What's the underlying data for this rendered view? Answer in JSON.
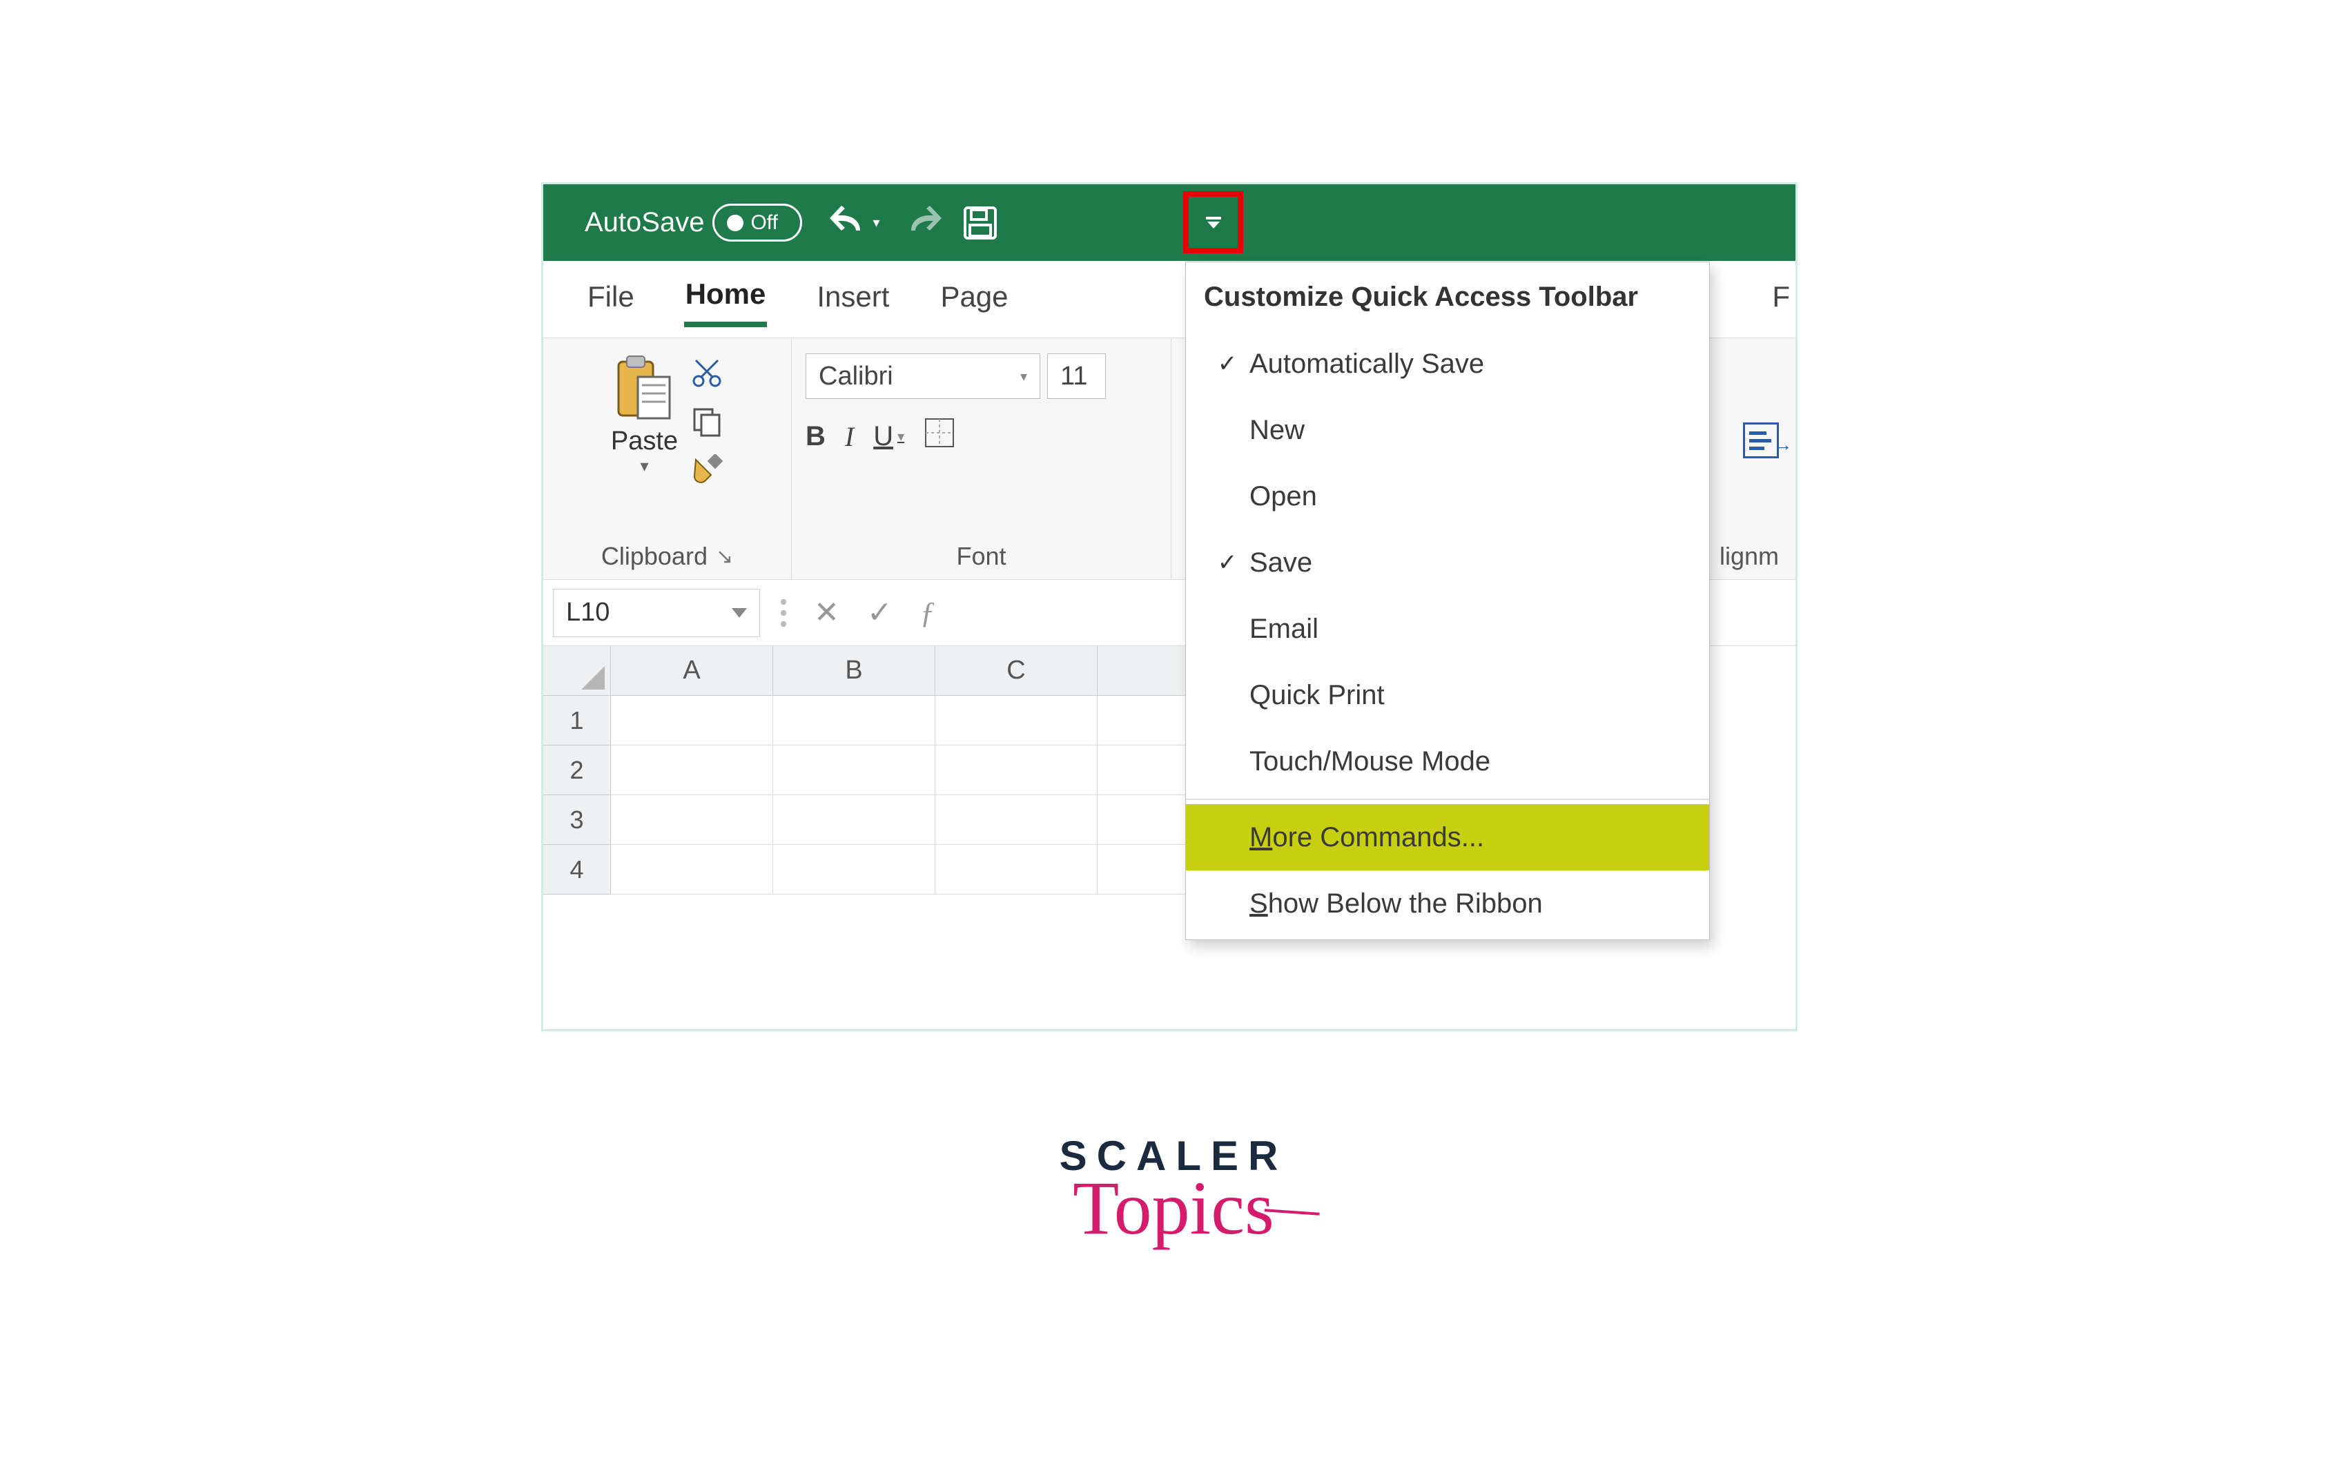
{
  "titlebar": {
    "autosave_label": "AutoSave",
    "autosave_state": "Off"
  },
  "tabs": {
    "file": "File",
    "home": "Home",
    "insert": "Insert",
    "pagelayout": "Page",
    "right_peek": "F"
  },
  "ribbon": {
    "clipboard": {
      "paste": "Paste",
      "label": "Clipboard"
    },
    "font": {
      "name": "Calibri",
      "size": "11",
      "label": "Font"
    },
    "alignment": {
      "label_partial": "lignm"
    }
  },
  "formula": {
    "namebox": "L10"
  },
  "columns": [
    "A",
    "B",
    "C",
    ""
  ],
  "rows": [
    "1",
    "2",
    "3",
    "4"
  ],
  "dropdown": {
    "title": "Customize Quick Access Toolbar",
    "items": [
      {
        "label": "Automatically Save",
        "checked": true
      },
      {
        "label": "New",
        "checked": false
      },
      {
        "label": "Open",
        "checked": false
      },
      {
        "label": "Save",
        "checked": true
      },
      {
        "label": "Email",
        "checked": false
      },
      {
        "label": "Quick Print",
        "checked": false
      },
      {
        "label": "Touch/Mouse Mode",
        "checked": false
      }
    ],
    "more_commands": "More Commands...",
    "more_commands_key": "M",
    "show_below": "Show Below the Ribbon",
    "show_below_key": "S"
  },
  "watermark": {
    "line1": "SCALER",
    "line2": "Topics"
  }
}
